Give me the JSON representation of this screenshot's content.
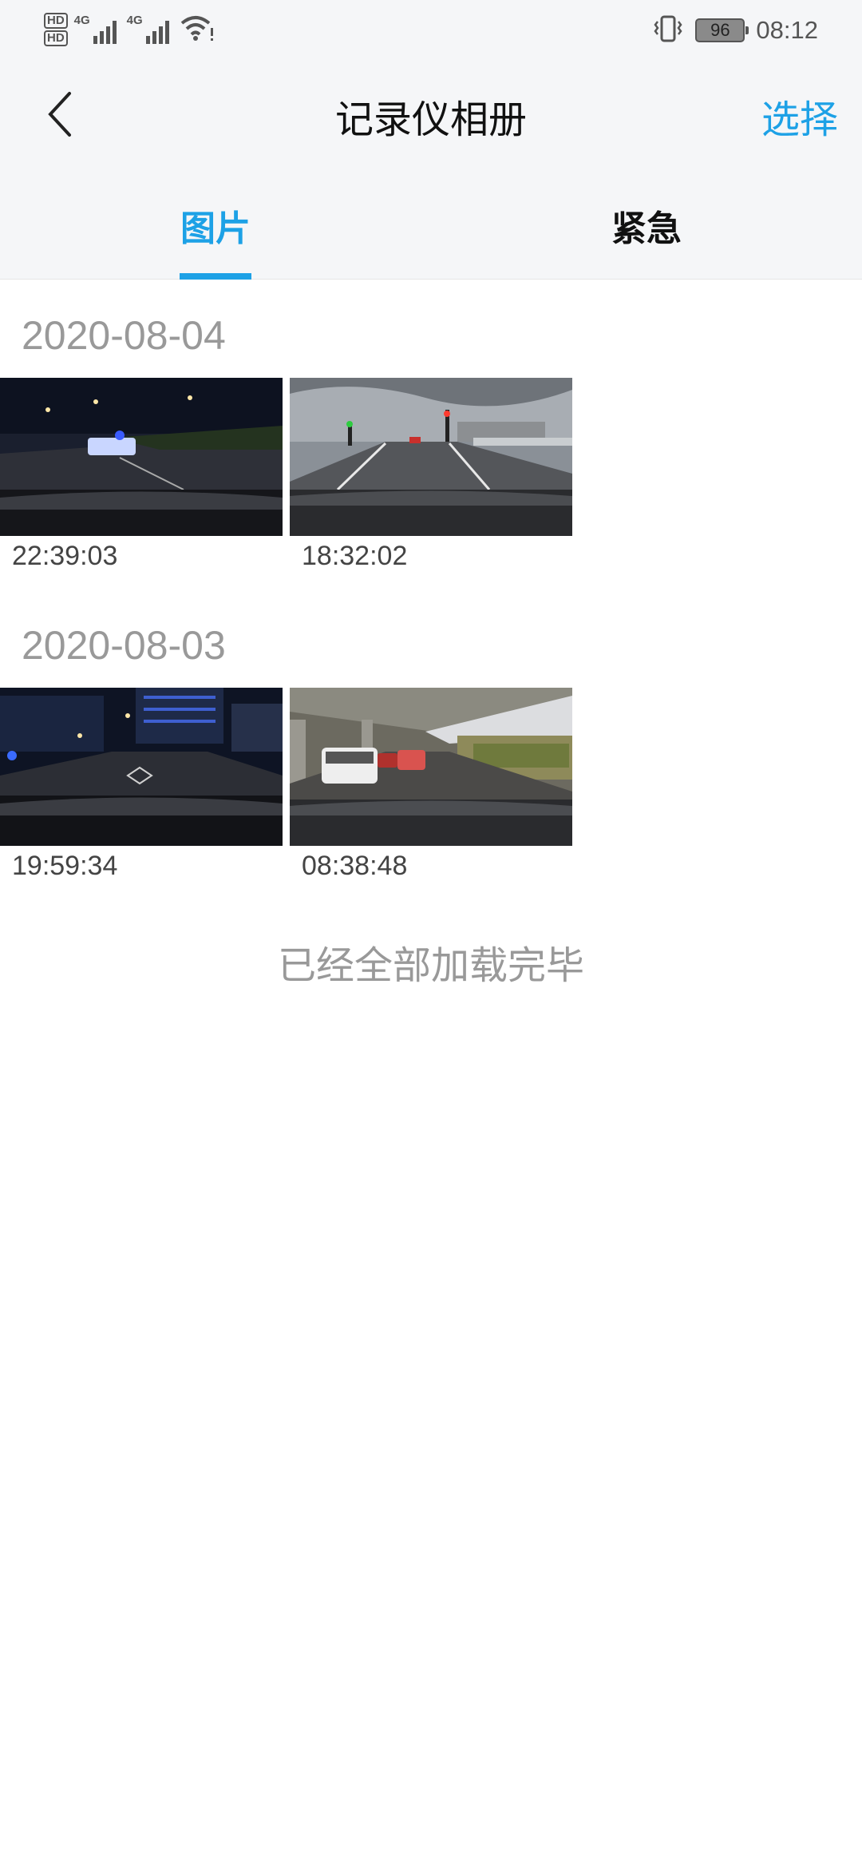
{
  "status_bar": {
    "hd1": "HD",
    "hd2": "HD",
    "sim1_net": "4G",
    "sim2_net": "4G",
    "battery": "96",
    "time": "08:12",
    "icons": [
      "signal-icon",
      "wifi-icon",
      "vibrate-icon",
      "battery-icon"
    ]
  },
  "nav": {
    "title": "记录仪相册",
    "select_label": "选择",
    "back_icon": "chevron-left-icon"
  },
  "tabs": [
    {
      "label": "图片",
      "active": true
    },
    {
      "label": "紧急",
      "active": false
    }
  ],
  "groups": [
    {
      "date": "2020-08-04",
      "items": [
        {
          "time": "22:39:03",
          "scene": "night-road"
        },
        {
          "time": "18:32:02",
          "scene": "cloudy-bridge"
        }
      ]
    },
    {
      "date": "2020-08-03",
      "items": [
        {
          "time": "19:59:34",
          "scene": "night-street"
        },
        {
          "time": "08:38:48",
          "scene": "under-overpass"
        }
      ]
    }
  ],
  "footer": "已经全部加载完毕",
  "colors": {
    "accent": "#1da1e6",
    "muted_text": "#999999"
  }
}
